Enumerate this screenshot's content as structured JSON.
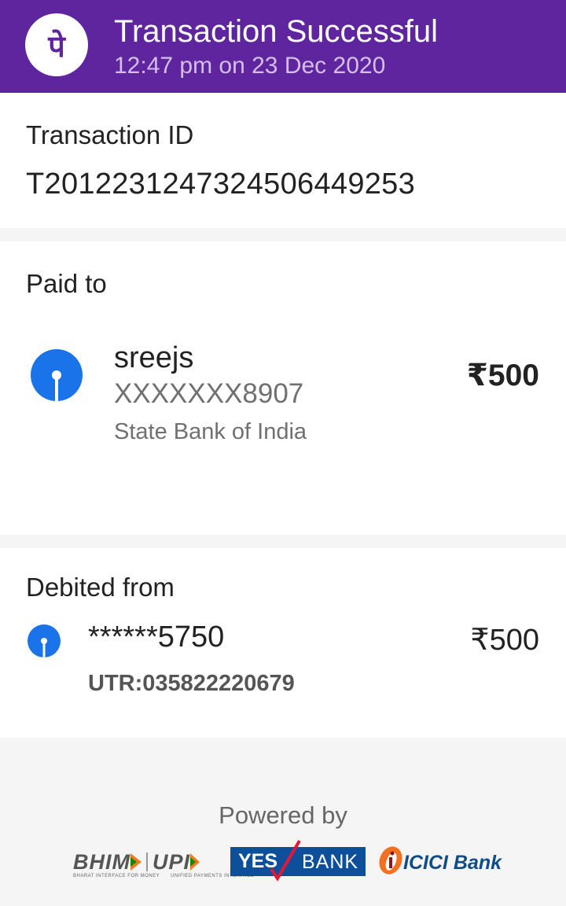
{
  "header": {
    "title": "Transaction Successful",
    "subtitle": "12:47 pm on 23 Dec 2020",
    "logo_glyph": "पे",
    "background": "#5f259f"
  },
  "transaction": {
    "label": "Transaction ID",
    "id": "T2012231247324506449253"
  },
  "paid_to": {
    "label": "Paid to",
    "name": "sreejs",
    "account": "XXXXXXX8907",
    "bank": "State Bank of India",
    "amount": "₹500",
    "icon": "sbi-logo-icon"
  },
  "debited_from": {
    "label": "Debited from",
    "account": "******5750",
    "amount": "₹500",
    "utr": "UTR:035822220679",
    "icon": "sbi-logo-icon"
  },
  "footer": {
    "powered_by": "Powered by",
    "partners": {
      "bhim": "BHIM",
      "bhim_tagline": "BHARAT INTERFACE FOR MONEY",
      "upi": "UPI",
      "upi_tagline": "UNIFIED PAYMENTS INTERFACE",
      "yes": "YES",
      "bank": "BANK",
      "icici": "ICICI Bank"
    }
  },
  "colors": {
    "sbi_blue": "#1a73e8",
    "yes_bank_blue": "#0d4f9b",
    "yes_bank_red": "#e31837",
    "icici_orange": "#f37021",
    "icici_blue": "#0f4d8a"
  }
}
